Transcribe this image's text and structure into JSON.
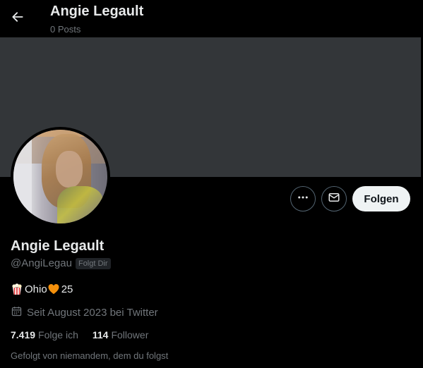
{
  "header": {
    "title": "Angie Legault",
    "subtitle": "0 Posts",
    "back_icon": "arrow-left-icon"
  },
  "colors": {
    "background": "#000000",
    "banner": "#333639",
    "text_primary": "#e7e9ea",
    "text_secondary": "#71767b",
    "follow_button_bg": "#eff3f4",
    "button_border": "#536471"
  },
  "actions": {
    "more_icon": "more-horizontal-icon",
    "message_icon": "envelope-icon",
    "follow_label": "Folgen"
  },
  "profile": {
    "display_name": "Angie Legault",
    "handle": "@AngiLegau",
    "follows_you_badge": "Folgt Dir",
    "bio_icons": [
      "popcorn-icon",
      "orange-heart-icon"
    ],
    "bio_part1": "Ohio",
    "bio_part2": "25",
    "joined_icon": "calendar-icon",
    "joined": "Seit August 2023 bei Twitter"
  },
  "stats": {
    "following_count": "7.419",
    "following_label": "Folge ich",
    "followers_count": "114",
    "followers_label": "Follower"
  },
  "followed_by": "Gefolgt von niemandem, dem du folgst"
}
